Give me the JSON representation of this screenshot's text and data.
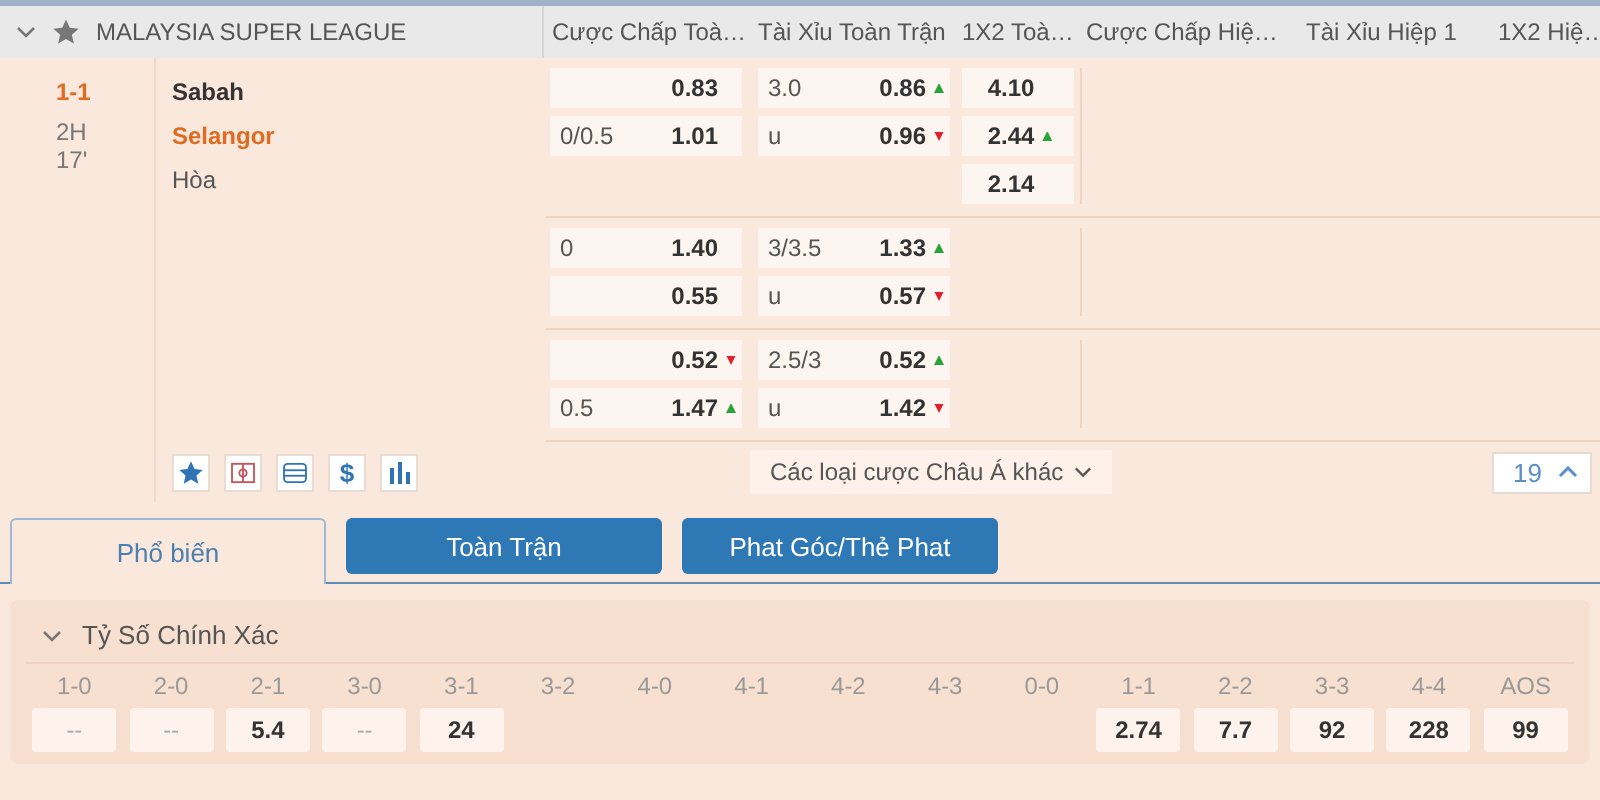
{
  "league": {
    "name": "MALAYSIA SUPER LEAGUE",
    "expanded": true,
    "favorite": false
  },
  "columns": [
    "Cược Chấp Toà…",
    "Tài Xỉu Toàn Trận",
    "1X2 Toà…",
    "Cược Chấp Hiệ…",
    "Tài Xỉu Hiệp 1",
    "1X2 Hiệ…"
  ],
  "match": {
    "score": "1-1",
    "period": "2H",
    "minute": "17'",
    "home": "Sabah",
    "away": "Selangor",
    "draw": "Hòa"
  },
  "groups": [
    {
      "handicap": [
        {
          "odds": "0.83"
        },
        {
          "line": "0/0.5",
          "odds": "1.01"
        }
      ],
      "over_under": [
        {
          "line": "3.0",
          "odds": "0.86",
          "rising": true
        },
        {
          "line": "u",
          "odds": "0.96",
          "rising": false
        }
      ],
      "x12": [
        {
          "odds": "4.10"
        },
        {
          "odds": "2.44",
          "rising": true
        },
        {
          "odds": "2.14"
        }
      ]
    },
    {
      "handicap": [
        {
          "line": "0",
          "odds": "1.40"
        },
        {
          "odds": "0.55"
        }
      ],
      "over_under": [
        {
          "line": "3/3.5",
          "odds": "1.33",
          "rising": true
        },
        {
          "line": "u",
          "odds": "0.57",
          "rising": false
        }
      ]
    },
    {
      "handicap": [
        {
          "odds": "0.52",
          "rising": false
        },
        {
          "line": "0.5",
          "odds": "1.47",
          "rising": true
        }
      ],
      "over_under": [
        {
          "line": "2.5/3",
          "odds": "0.52",
          "rising": true
        },
        {
          "line": "u",
          "odds": "1.42",
          "rising": false
        }
      ]
    }
  ],
  "tools": [
    {
      "kind": "star"
    },
    {
      "kind": "field"
    },
    {
      "kind": "list"
    },
    {
      "kind": "text",
      "text": "$"
    },
    {
      "kind": "chart"
    }
  ],
  "more_link": "Các loại cược Châu Á khác",
  "counter": "19",
  "tabs": [
    {
      "label": "Phổ biến",
      "selected": true
    },
    {
      "label": "Toàn Trận",
      "selected": false
    },
    {
      "label": "Phat Góc/Thẻ Phat",
      "selected": false
    }
  ],
  "section": {
    "title": "Tỷ Số Chính Xác",
    "expanded": true
  },
  "scores": [
    {
      "label": "1-0",
      "odds": "--"
    },
    {
      "label": "2-0",
      "odds": "--"
    },
    {
      "label": "2-1",
      "odds": "5.4"
    },
    {
      "label": "3-0",
      "odds": "--"
    },
    {
      "label": "3-1",
      "odds": "24"
    },
    {
      "label": "3-2"
    },
    {
      "label": "4-0"
    },
    {
      "label": "4-1"
    },
    {
      "label": "4-2"
    },
    {
      "label": "4-3"
    },
    {
      "label": "0-0"
    },
    {
      "label": "1-1",
      "odds": "2.74"
    },
    {
      "label": "2-2",
      "odds": "7.7"
    },
    {
      "label": "3-3",
      "odds": "92"
    },
    {
      "label": "4-4",
      "odds": "228"
    },
    {
      "label": "AOS",
      "odds": "99"
    }
  ]
}
